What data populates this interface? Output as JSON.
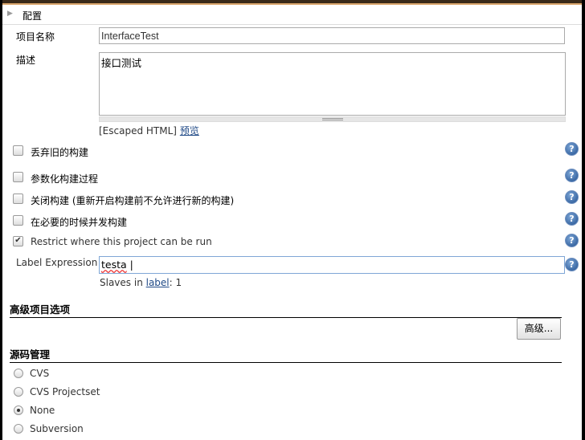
{
  "section_config": "配置",
  "project_name": {
    "label": "项目名称",
    "value": "InterfaceTest"
  },
  "description": {
    "label": "描述",
    "value": "接口测试",
    "escaped": "[Escaped HTML]",
    "preview": "预览"
  },
  "options": [
    {
      "label": "丢弃旧的构建",
      "checked": false
    },
    {
      "label": "参数化构建过程",
      "checked": false
    },
    {
      "label": "关闭构建 (重新开启构建前不允许进行新的构建)",
      "checked": false
    },
    {
      "label": "在必要的时候并发构建",
      "checked": false
    },
    {
      "label": "Restrict where this project can be run",
      "checked": true
    }
  ],
  "label_expression": {
    "label": "Label Expression",
    "value": "testa",
    "slaves_prefix": "Slaves in ",
    "slaves_link": "label",
    "slaves_suffix": ": 1"
  },
  "advanced_section": {
    "title": "高级项目选项",
    "button": "高级..."
  },
  "scm_section": {
    "title": "源码管理",
    "options": [
      {
        "label": "CVS",
        "selected": false
      },
      {
        "label": "CVS Projectset",
        "selected": false
      },
      {
        "label": "None",
        "selected": true
      },
      {
        "label": "Subversion",
        "selected": false
      }
    ]
  }
}
